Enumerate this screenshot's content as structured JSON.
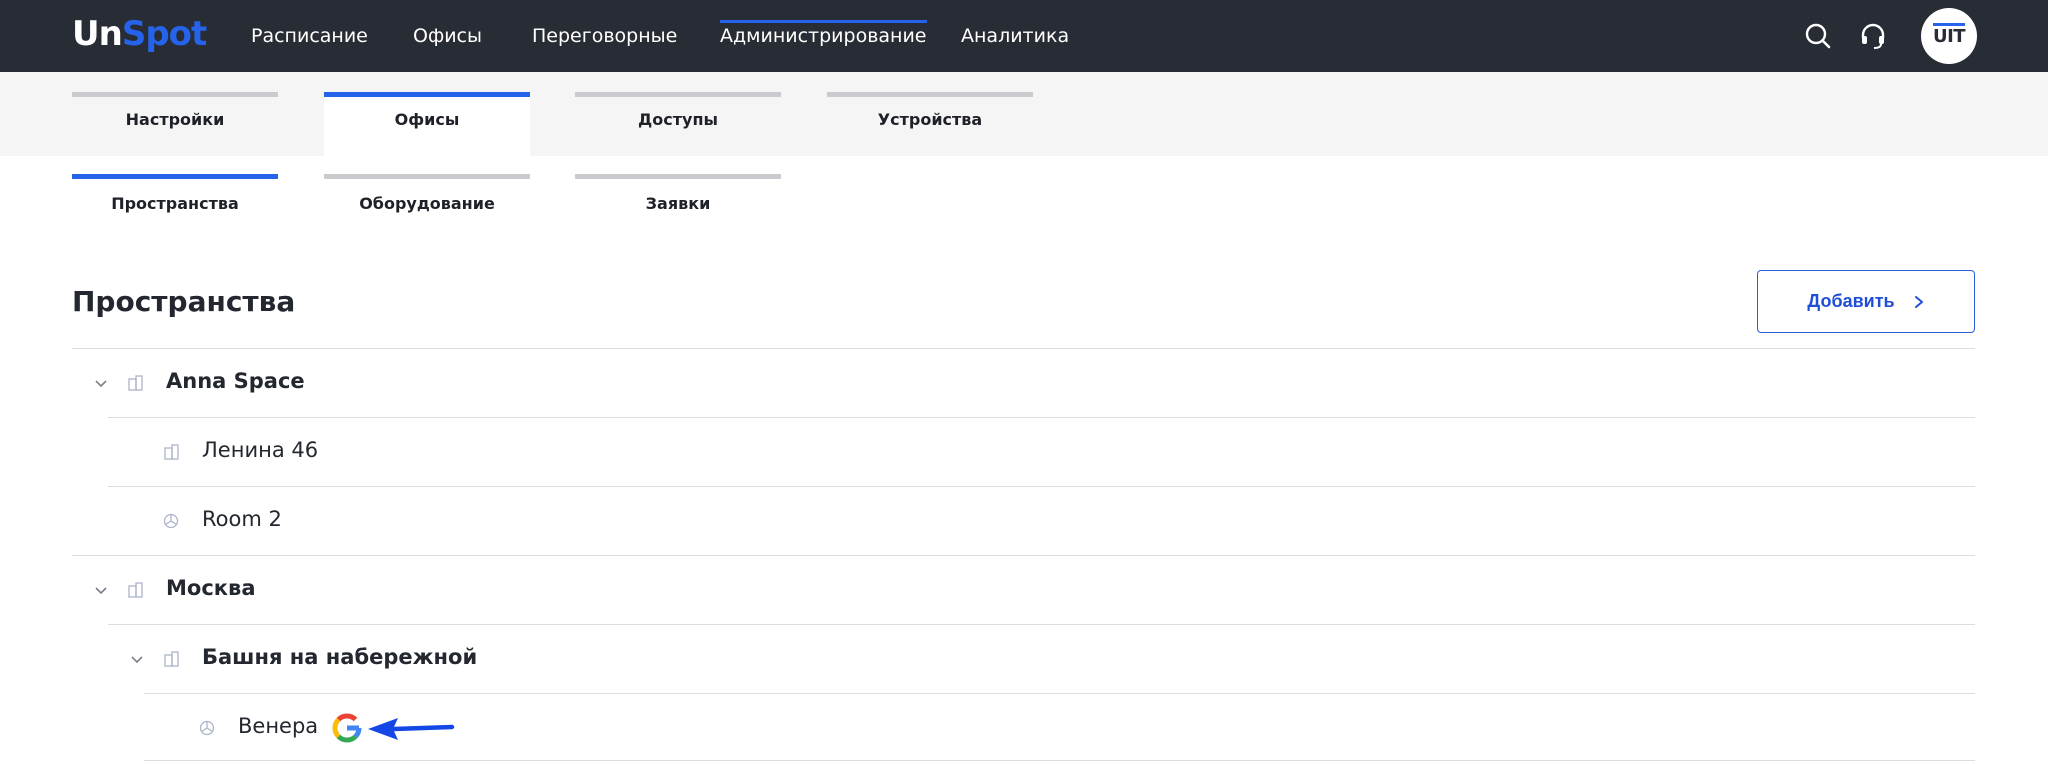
{
  "app": {
    "logo_un": "Un",
    "logo_spot": "Spot"
  },
  "nav": {
    "items": [
      {
        "label": "Расписание",
        "active": false
      },
      {
        "label": "Офисы",
        "active": false
      },
      {
        "label": "Переговорные",
        "active": false
      },
      {
        "label": "Администрирование",
        "active": true
      },
      {
        "label": "Аналитика",
        "active": false
      }
    ],
    "icons": [
      "search-icon",
      "headset-icon"
    ],
    "avatar_text": "UIT"
  },
  "tabs": [
    {
      "label": "Настройки",
      "active": false
    },
    {
      "label": "Офисы",
      "active": true
    },
    {
      "label": "Доступы",
      "active": false
    },
    {
      "label": "Устройства",
      "active": false
    }
  ],
  "subtabs": [
    {
      "label": "Пространства",
      "active": true
    },
    {
      "label": "Оборудование",
      "active": false
    },
    {
      "label": "Заявки",
      "active": false
    }
  ],
  "section": {
    "title": "Пространства",
    "add_label": "Добавить"
  },
  "tree": [
    {
      "label": "Anna Space",
      "bold": true,
      "icon": "building-icon",
      "expanded": true
    },
    {
      "label": "Ленина 46",
      "bold": false,
      "icon": "building-icon"
    },
    {
      "label": "Room 2",
      "bold": false,
      "icon": "room-icon"
    },
    {
      "label": "Москва",
      "bold": true,
      "icon": "building-icon",
      "expanded": true
    },
    {
      "label": "Башня на набережной",
      "bold": true,
      "icon": "building-icon",
      "expanded": true
    },
    {
      "label": "Венера",
      "bold": false,
      "icon": "room-icon",
      "badge": "google-icon",
      "annotation": "arrow-pointer"
    }
  ],
  "colors": {
    "accent": "#2563eb",
    "topbar": "#282c34",
    "band": "#f5f5f5"
  }
}
